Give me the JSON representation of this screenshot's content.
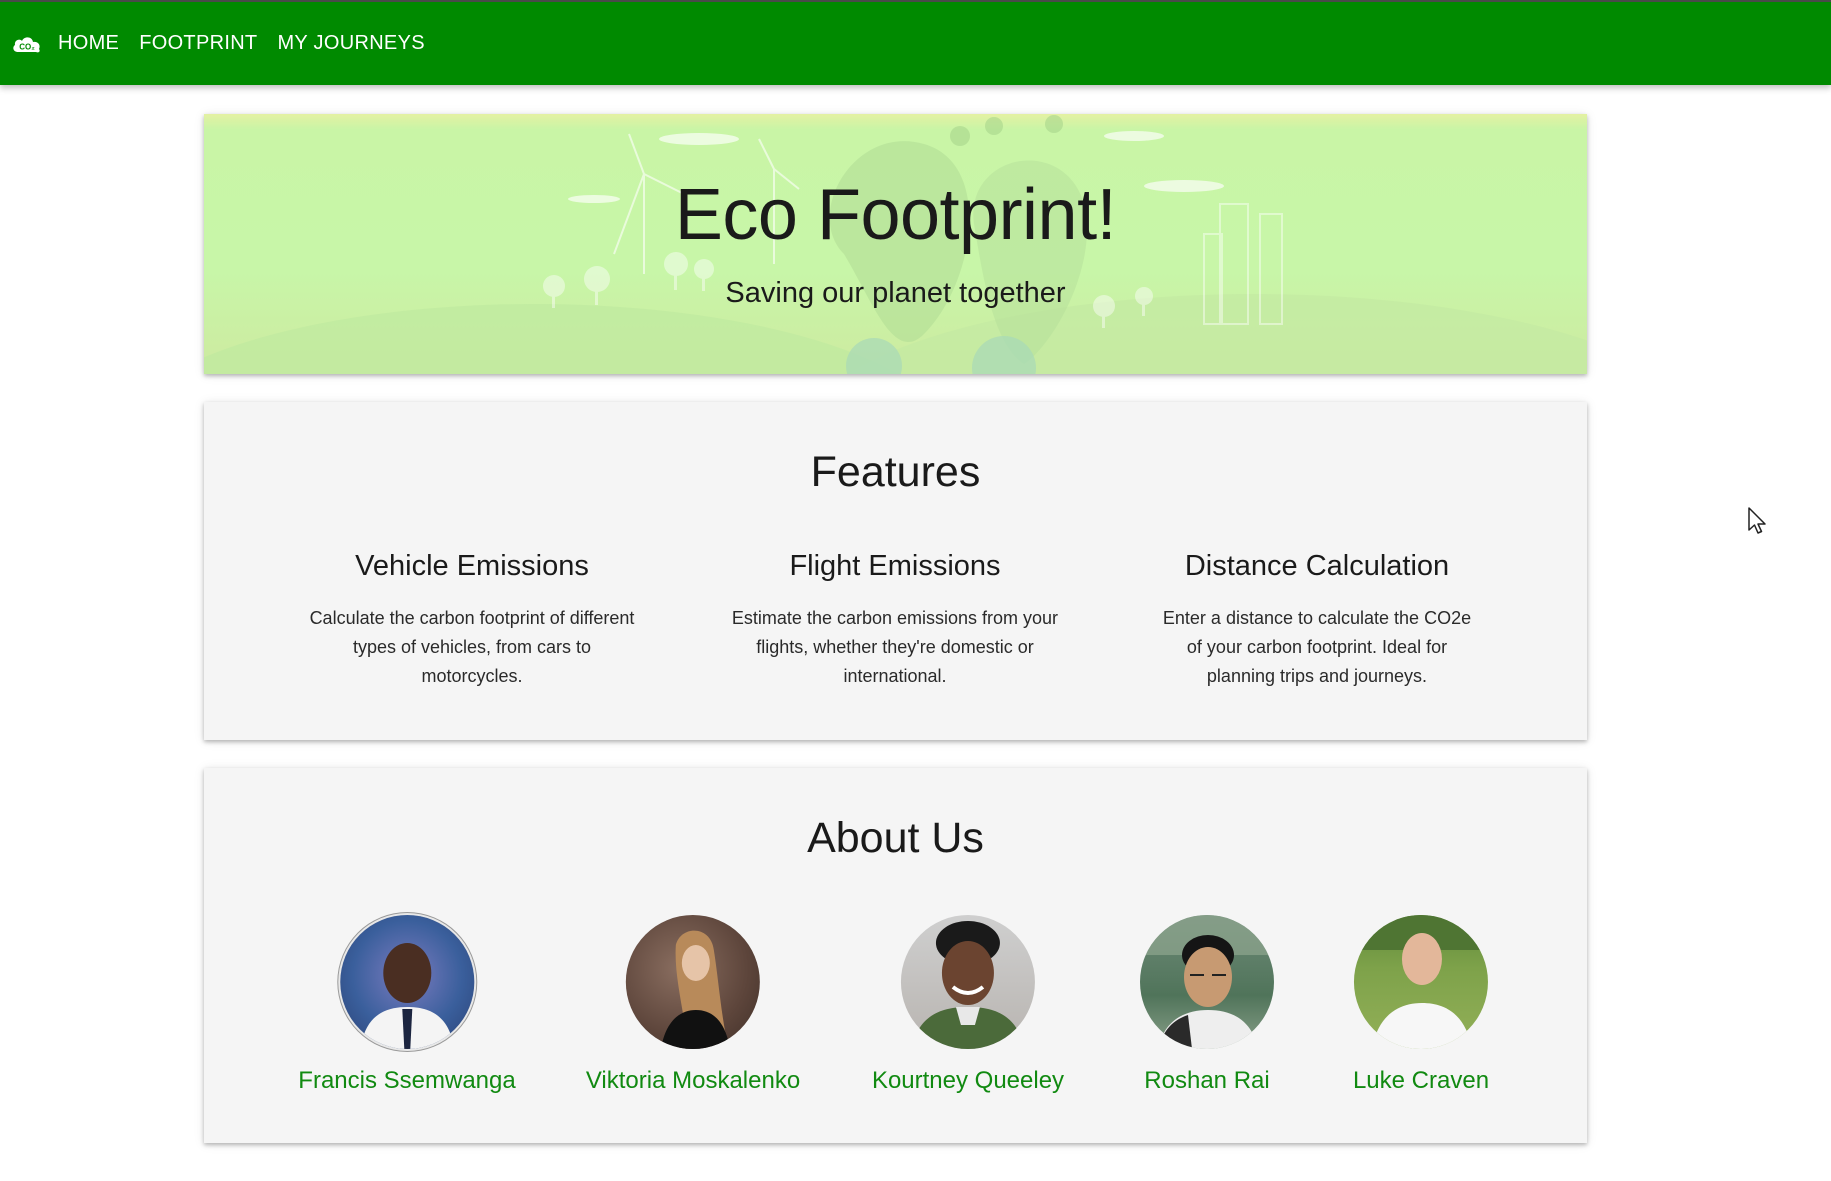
{
  "nav": {
    "logo_icon": "co2-cloud-icon",
    "logo_text": "CO₂",
    "links": [
      "HOME",
      "FOOTPRINT",
      "MY JOURNEYS"
    ],
    "background_color": "#008a00"
  },
  "hero": {
    "title": "Eco Footprint!",
    "subtitle": "Saving our planet together"
  },
  "features": {
    "title": "Features",
    "items": [
      {
        "heading": "Vehicle Emissions",
        "text": "Calculate the carbon footprint of different types of vehicles, from cars to motorcycles."
      },
      {
        "heading": "Flight Emissions",
        "text": "Estimate the carbon emissions from your flights, whether they're domestic or international."
      },
      {
        "heading": "Distance Calculation",
        "text": "Enter a distance to calculate the CO2e of your carbon footprint. Ideal for planning trips and journeys."
      }
    ]
  },
  "about": {
    "title": "About Us",
    "members": [
      {
        "name": "Francis Ssemwanga"
      },
      {
        "name": "Viktoria Moskalenko"
      },
      {
        "name": "Kourtney Queeley"
      },
      {
        "name": "Roshan Rai"
      },
      {
        "name": "Luke Craven"
      }
    ],
    "name_color": "#118a11"
  }
}
